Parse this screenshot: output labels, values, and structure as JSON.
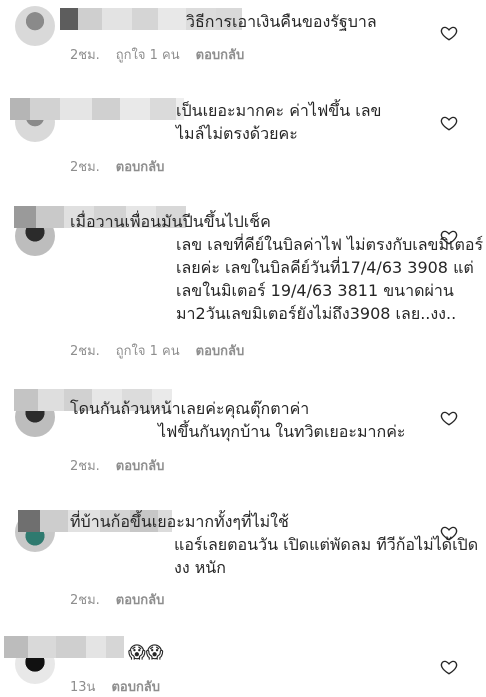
{
  "comments": [
    {
      "text": "วิธีการเอาเงินคืนของรัฐบาล",
      "time": "2ชม.",
      "likes": "ถูกใจ 1 คน",
      "reply": "ตอบกลับ"
    },
    {
      "text": "เป็นเยอะมากคะ ค่าไฟขึ้น เลข\nไมล์ไม่ตรงด้วยคะ",
      "time": "2ชม.",
      "likes": "",
      "reply": "ตอบกลับ"
    },
    {
      "text": "เมื่อวานเพื่อนมันปีนขึ้นไปเช็ค\nเลข เลขที่คีย์ในบิลค่าไฟ ไม่ตรงกับเลขมิเตอร์\nเลยค่ะ  เลขในบิลคีย์วันที่17/4/63  3908 แต่\nเลขในมิเตอร์ 19/4/63  3811  ขนาดผ่าน\nมา2วันเลขมิเตอร์ยังไม่ถึง3908 เลย..งง..",
      "time": "2ชม.",
      "likes": "ถูกใจ 1 คน",
      "reply": "ตอบกลับ"
    },
    {
      "text": "โดนกันถ้วนหน้าเลยค่ะคุณตุ๊กตาค่า\nไฟขึ้นกันทุกบ้าน ในทวิตเยอะมากค่ะ",
      "time": "2ชม.",
      "likes": "",
      "reply": "ตอบกลับ"
    },
    {
      "text": "ที่บ้านก้อขึ้นเยอะมากทั้งๆที่ไม่ใช้\nแอร์เลยตอนวัน เปิดแต่พัดลม ทีวีก้อไม่ได้เปิด\nงง หนัก",
      "time": "2ชม.",
      "likes": "",
      "reply": "ตอบกลับ"
    },
    {
      "text": "😱😱",
      "time": "13น",
      "likes": "",
      "reply": "ตอบกลับ"
    }
  ],
  "icons": {
    "like": "heart-outline-icon"
  }
}
